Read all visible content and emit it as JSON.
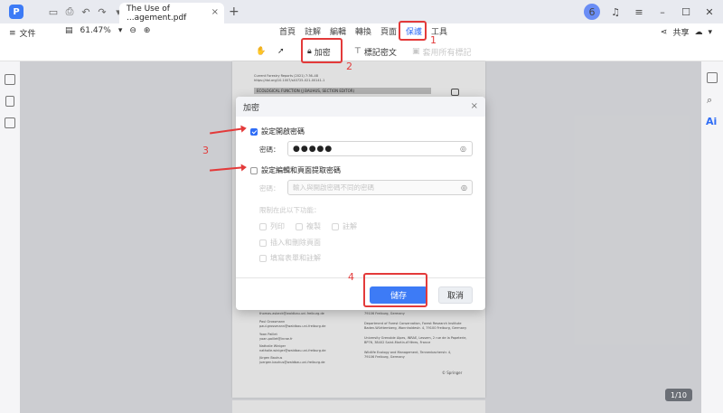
{
  "titlebar": {
    "tab_title": "The Use of ...agement.pdf",
    "tab_close": "×",
    "tab_add": "+",
    "avatar_letter": "6",
    "minimize": "–",
    "maximize": "☐",
    "close": "✕"
  },
  "toolbar": {
    "file_label": "文件",
    "zoom_value": "61.47%",
    "menu_tabs": [
      "首頁",
      "註解",
      "編輯",
      "轉換",
      "頁面",
      "保護",
      "工具"
    ],
    "active_tab_index": 5,
    "share_label": "共享"
  },
  "protect_toolbar": {
    "encrypt_label": "加密",
    "redact_label": "標記密文",
    "apply_label": "套用所有標記"
  },
  "document": {
    "header_line1": "Current Forestry Reports (2021) 7:36–48",
    "header_line2": "https://doi.org/10.1007/s40725-021-00141-1",
    "banner": "ECOLOGICAL FUNCTION (J BAUHUS, SECTION EDITOR)",
    "contacts_left": [
      "thomas.asbeck@waldbau.uni-freiburg.de",
      "Paul Grossmann",
      "paul.grossmann@waldbau.uni-freiburg.de",
      "Yoan Paillet",
      "yoan.paillet@inrae.fr",
      "Nathalie Winiger",
      "nathalie.winiger@waldbau.uni-freiburg.de",
      "Jürgen Bauhus",
      "juergen.bauhus@waldbau.uni-freiburg.de"
    ],
    "affiliations_right": [
      "79106 Freiburg, Germany",
      "Department of Forest Conservation, Forest Research Institute",
      "Baden-Württemberg, Wonnhaldestr. 4, 79100 Freiburg, Germany",
      "University Grenoble Alpes, INRAE, Lessem, 2 rue de la Papeterie,",
      "BP76, 38402 Saint-Martin-d'Hères, France",
      "Wildlife Ecology and Management, Tennenbacherstr. 4,",
      "79106 Freiburg, Germany",
      "© Springer"
    ],
    "page_indicator": "1/10"
  },
  "dialog": {
    "title": "加密",
    "close": "×",
    "open_password_checkbox": "設定開啟密碼",
    "open_password_checked": true,
    "password_label": "密碼：",
    "password_value": "●●●●●",
    "permission_checkbox": "設定編輯和頁面提取密碼",
    "permission_checked": false,
    "permission_label": "密碼：",
    "permission_placeholder": "輸入與開啟密碼不同的密碼",
    "restrict_label": "限制在此以下功能：",
    "opt_print": "列印",
    "opt_copy": "複製",
    "opt_annotate": "註解",
    "opt_insert": "插入和刪除頁面",
    "opt_fill": "填寫表單和註解",
    "save_label": "儲存",
    "cancel_label": "取消"
  },
  "annotations": {
    "n1": "1",
    "n2": "2",
    "n3": "3",
    "n4": "4"
  },
  "colors": {
    "accent": "#3d7bf6",
    "annotation_red": "#e33a3a"
  }
}
